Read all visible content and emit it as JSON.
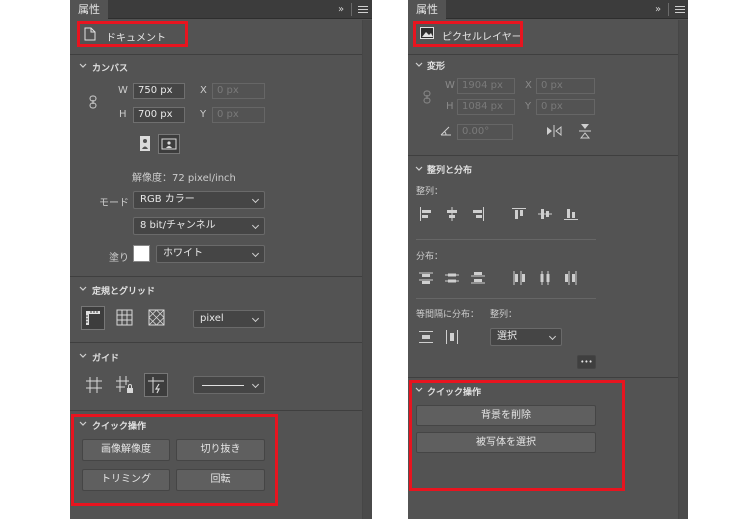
{
  "left": {
    "tab": "属性",
    "collapse": "»",
    "doc_label": "ドキュメント",
    "canvas": {
      "title": "カンバス",
      "w_label": "W",
      "w_value": "750 px",
      "h_label": "H",
      "h_value": "700 px",
      "x_label": "X",
      "x_placeholder": "0 px",
      "y_label": "Y",
      "y_placeholder": "0 px",
      "resolution": "解像度：72 pixel/inch",
      "mode_label": "モード",
      "mode_value": "RGB カラー",
      "depth_value": "8 bit/チャンネル",
      "fill_label": "塗り",
      "fill_value": "ホワイト",
      "fill_color": "#ffffff"
    },
    "rulers": {
      "title": "定規とグリッド",
      "unit": "pixel"
    },
    "guides": {
      "title": "ガイド"
    },
    "quick": {
      "title": "クイック操作",
      "buttons": [
        "画像解像度",
        "切り抜き",
        "トリミング",
        "回転"
      ]
    }
  },
  "right": {
    "tab": "属性",
    "collapse": "»",
    "layer_label": "ピクセルレイヤー",
    "transform": {
      "title": "変形",
      "w_label": "W",
      "w_placeholder": "1904 px",
      "h_label": "H",
      "h_placeholder": "1084 px",
      "x_label": "X",
      "x_placeholder": "0 px",
      "y_label": "Y",
      "y_placeholder": "0 px",
      "angle_placeholder": "0.00°"
    },
    "align": {
      "title": "整列と分布",
      "align_label": "整列：",
      "distribute_label": "分布：",
      "spacing_label": "等間隔に分布：",
      "spacing_align_label": "整列：",
      "spacing_align_value": "選択",
      "more": "•••"
    },
    "quick": {
      "title": "クイック操作",
      "buttons": [
        "背景を削除",
        "被写体を選択"
      ]
    }
  },
  "colors": {
    "highlight": "#e8141f",
    "panel": "#535353"
  }
}
